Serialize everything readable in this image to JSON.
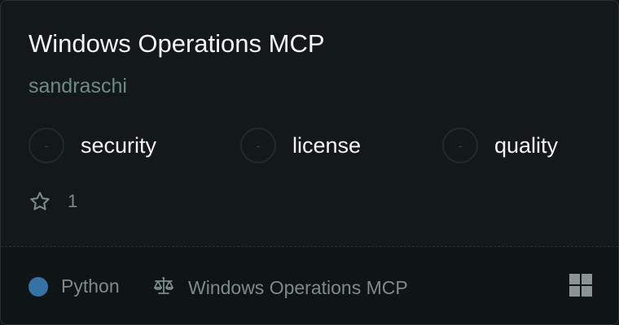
{
  "card": {
    "title": "Windows Operations MCP",
    "author": "sandraschi",
    "badges": [
      {
        "score": "-",
        "label": "security"
      },
      {
        "score": "-",
        "label": "license"
      },
      {
        "score": "-",
        "label": "quality"
      }
    ],
    "stars": "1",
    "language": "Python",
    "language_color": "#3572a5",
    "license_text": "Windows Operations MCP",
    "icons": {
      "star": "star-icon",
      "license": "scale-icon",
      "os": "windows-icon"
    }
  }
}
